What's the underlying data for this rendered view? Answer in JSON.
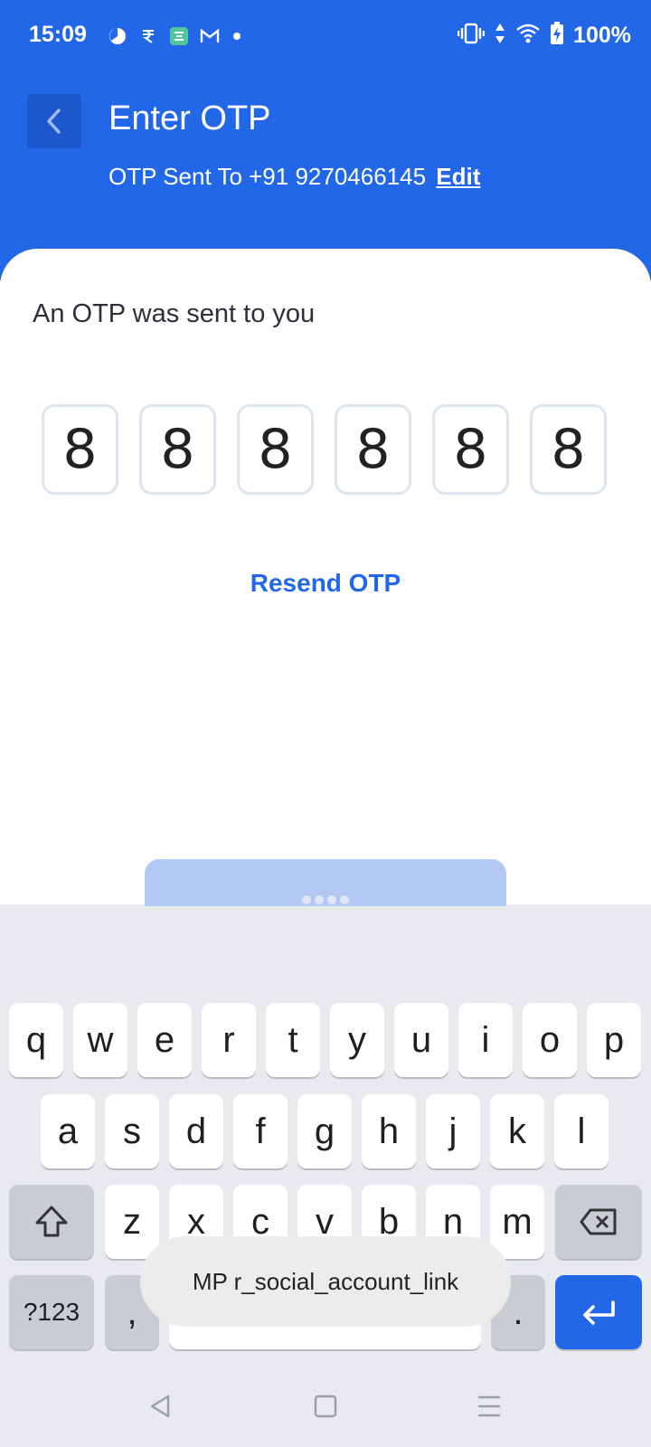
{
  "status_bar": {
    "time": "15:09",
    "battery": "100%",
    "notification_icons": [
      "pie-chart-icon",
      "rupee-icon",
      "app-icon",
      "gmail-icon",
      "dot-icon"
    ],
    "system_icons": [
      "vibrate-icon",
      "data-arrows-icon",
      "wifi-icon",
      "battery-charging-icon"
    ]
  },
  "header": {
    "title": "Enter OTP",
    "otp_sent_text": "OTP Sent To +91 9270466145",
    "edit_label": "Edit"
  },
  "otp": {
    "heading": "An OTP was sent to you",
    "digits": [
      "8",
      "8",
      "8",
      "8",
      "8",
      "8"
    ],
    "resend_label": "Resend OTP"
  },
  "keyboard": {
    "row1": [
      "q",
      "w",
      "e",
      "r",
      "t",
      "y",
      "u",
      "i",
      "o",
      "p"
    ],
    "row2": [
      "a",
      "s",
      "d",
      "f",
      "g",
      "h",
      "j",
      "k",
      "l"
    ],
    "row3": [
      "z",
      "x",
      "c",
      "v",
      "b",
      "n",
      "m"
    ],
    "symbols_label": "?123",
    "comma_label": ",",
    "period_label": ".",
    "suggestion": "MP r_social_account_link"
  },
  "colors": {
    "primary": "#2167e8",
    "button_disabled": "#b3c9f3",
    "otp_border": "#dde5ef"
  }
}
